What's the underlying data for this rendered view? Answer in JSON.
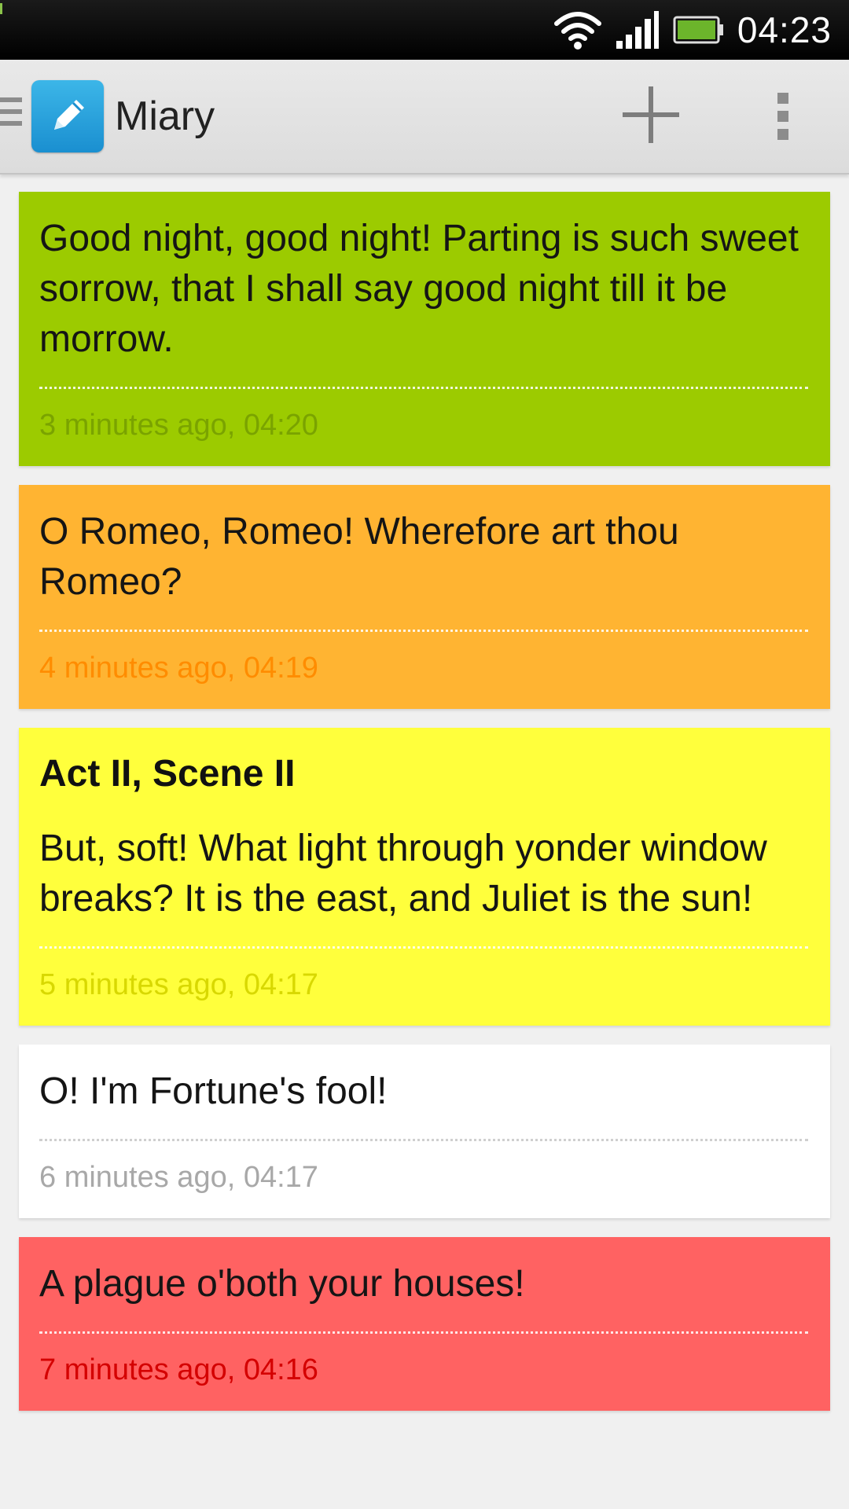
{
  "status_bar": {
    "time": "04:23",
    "icons": [
      "wifi-icon",
      "signal-icon",
      "battery-icon"
    ]
  },
  "action_bar": {
    "title": "Miary",
    "app_icon": "pencil-icon",
    "drawer_icon": "menu-icon",
    "add_icon": "plus-icon",
    "overflow_icon": "overflow-menu-icon"
  },
  "notes": [
    {
      "heading": "",
      "text": "Good night, good night! Parting is such sweet sorrow, that I shall say good night till it be morrow.",
      "time": "3 minutes ago, 04:20",
      "bg_color": "#9ccb00",
      "time_color": "#7aa300"
    },
    {
      "heading": "",
      "text": "O Romeo, Romeo! Wherefore art thou Romeo?",
      "time": "4 minutes ago, 04:19",
      "bg_color": "#ffb432",
      "time_color": "#ff8c00"
    },
    {
      "heading": "Act II, Scene II",
      "text": "But, soft! What light through yonder window breaks? It is the east, and Juliet is the sun!",
      "time": "5 minutes ago, 04:17",
      "bg_color": "#ffff3c",
      "time_color": "#d8d800"
    },
    {
      "heading": "",
      "text": "O! I'm Fortune's fool!",
      "time": "6 minutes ago, 04:17",
      "bg_color": "#ffffff",
      "time_color": "#a8a8a8"
    },
    {
      "heading": "",
      "text": "A plague o'both your houses!",
      "time": "7 minutes ago, 04:16",
      "bg_color": "#ff6262",
      "time_color": "#d40000"
    }
  ]
}
